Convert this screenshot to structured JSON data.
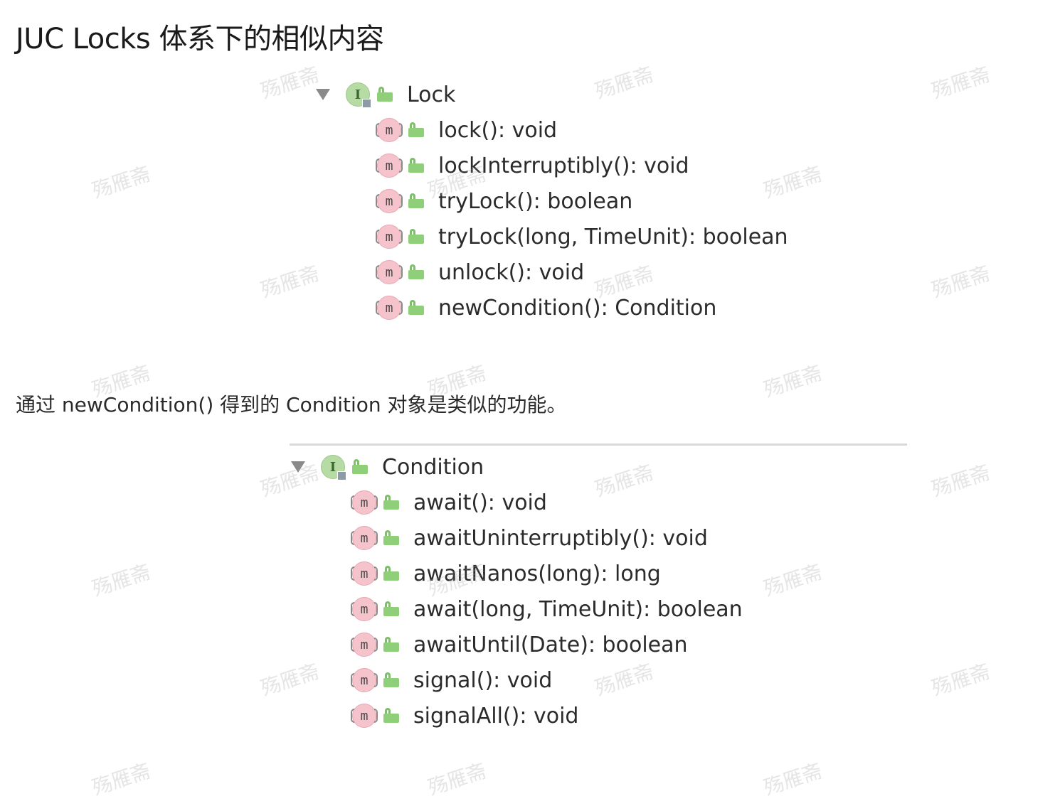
{
  "page": {
    "title": "JUC Locks 体系下的相似内容",
    "paragraph": "通过 newCondition() 得到的 Condition 对象是类似的功能。"
  },
  "lock_tree": {
    "root": {
      "label": "Lock",
      "icon": "interface-icon",
      "expanded": true
    },
    "methods": [
      {
        "label": "lock(): void",
        "icon": "method-icon"
      },
      {
        "label": "lockInterruptibly(): void",
        "icon": "method-icon"
      },
      {
        "label": "tryLock(): boolean",
        "icon": "method-icon"
      },
      {
        "label": "tryLock(long, TimeUnit): boolean",
        "icon": "method-icon"
      },
      {
        "label": "unlock(): void",
        "icon": "method-icon"
      },
      {
        "label": "newCondition(): Condition",
        "icon": "method-icon"
      }
    ]
  },
  "condition_tree": {
    "root": {
      "label": "Condition",
      "icon": "interface-icon",
      "expanded": true
    },
    "methods": [
      {
        "label": "await(): void",
        "icon": "method-icon"
      },
      {
        "label": "awaitUninterruptibly(): void",
        "icon": "method-icon"
      },
      {
        "label": "awaitNanos(long): long",
        "icon": "method-icon"
      },
      {
        "label": "await(long, TimeUnit): boolean",
        "icon": "method-icon"
      },
      {
        "label": "awaitUntil(Date): boolean",
        "icon": "method-icon"
      },
      {
        "label": "signal(): void",
        "icon": "method-icon"
      },
      {
        "label": "signalAll(): void",
        "icon": "method-icon"
      }
    ]
  },
  "icons": {
    "interface_letter": "I",
    "method_letter": "m"
  },
  "colors": {
    "interface_icon": "#b6dba4",
    "method_icon": "#f5c3cc",
    "public_access": "#8fcf7a",
    "toggle": "#8a8a8a"
  },
  "watermark": {
    "text": "殇雁斋"
  }
}
